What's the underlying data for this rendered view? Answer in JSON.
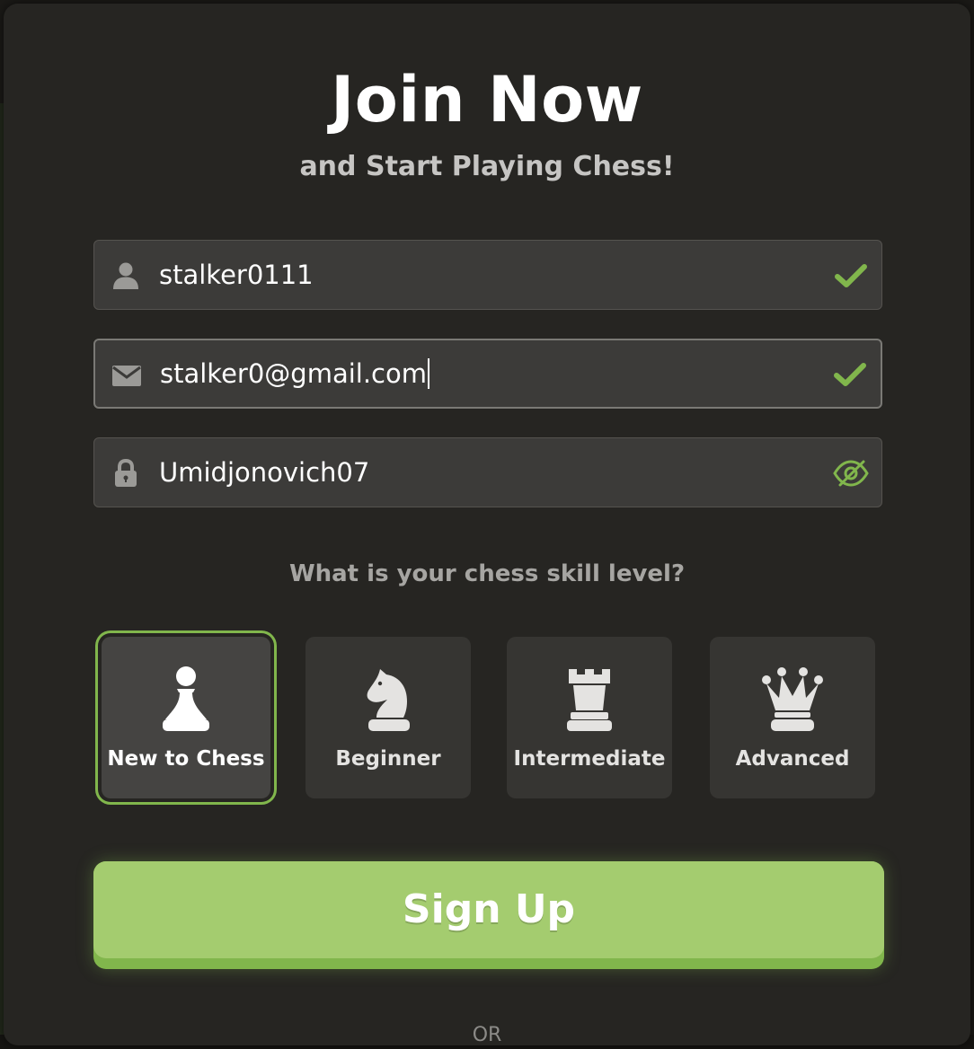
{
  "header": {
    "title": "Join Now",
    "subtitle": "and Start Playing Chess!"
  },
  "form": {
    "username": {
      "value": "stalker0111",
      "icon": "user-icon",
      "status_icon": "check-icon",
      "valid": true
    },
    "email": {
      "value": "stalker0@gmail.com",
      "icon": "envelope-icon",
      "status_icon": "check-icon",
      "valid": true,
      "focused": true
    },
    "password": {
      "value": "Umidjonovich07",
      "icon": "lock-icon",
      "toggle_icon": "eye-slash-icon",
      "visible": true
    }
  },
  "skill": {
    "question": "What is your chess skill level?",
    "options": [
      {
        "label": "New to Chess",
        "icon": "pawn-icon",
        "selected": true
      },
      {
        "label": "Beginner",
        "icon": "knight-icon",
        "selected": false
      },
      {
        "label": "Intermediate",
        "icon": "rook-icon",
        "selected": false
      },
      {
        "label": "Advanced",
        "icon": "queen-icon",
        "selected": false
      }
    ]
  },
  "actions": {
    "signup_label": "Sign Up",
    "or_label": "OR"
  },
  "colors": {
    "accent_green": "#81b64c",
    "button_face": "#a4cc6f",
    "modal_bg": "#262522",
    "field_bg": "#3c3b39"
  }
}
